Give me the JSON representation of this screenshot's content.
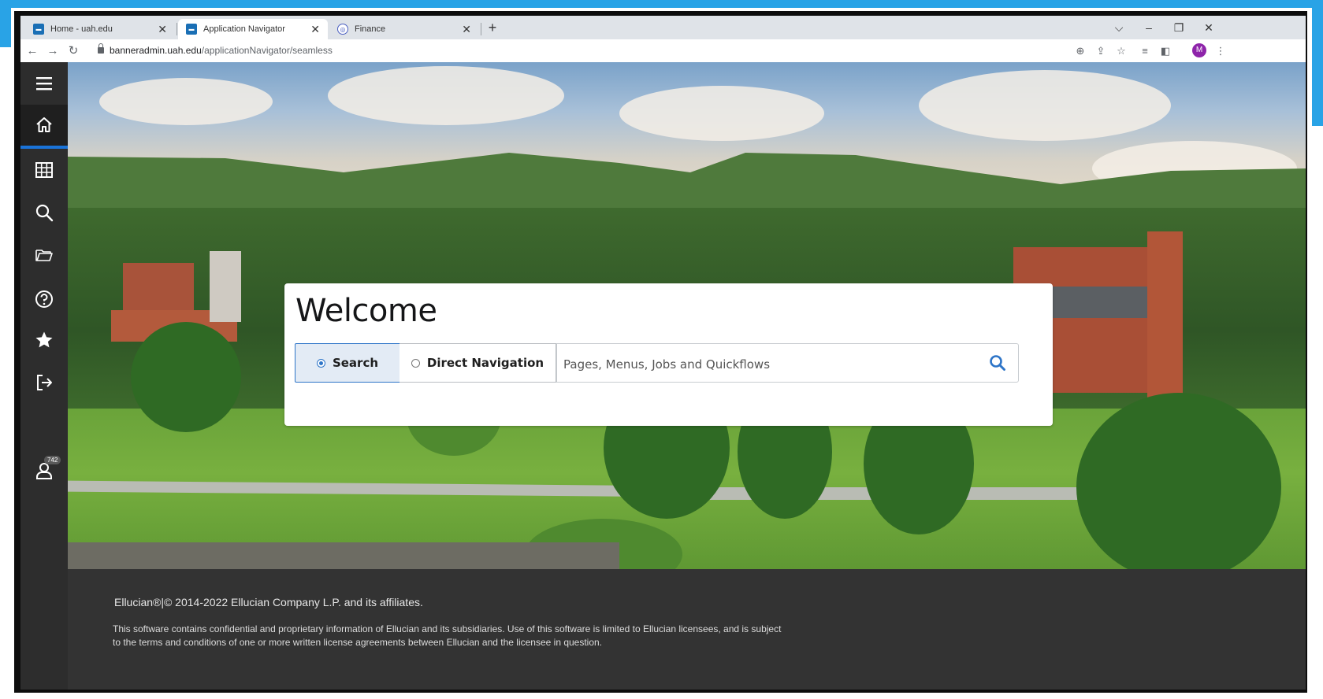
{
  "browser": {
    "tabs": [
      {
        "label": "Home - uah.edu",
        "active": false,
        "favicon_color": "#1a6fb5"
      },
      {
        "label": "Application Navigator",
        "active": true,
        "favicon_color": "#1a6fb5"
      },
      {
        "label": "Finance",
        "active": false,
        "favicon_color": "#4a5fc1"
      }
    ],
    "new_tab_icon": "plus-icon",
    "url_host": "banneradmin.uah.edu",
    "url_path": "/applicationNavigator/seamless",
    "profile_initial": "M",
    "profile_color": "#8e24aa"
  },
  "sidebar": {
    "items": [
      {
        "icon": "menu-icon"
      },
      {
        "icon": "home-icon",
        "active": true
      },
      {
        "icon": "grid-icon"
      },
      {
        "icon": "search-icon"
      },
      {
        "icon": "folder-icon"
      },
      {
        "icon": "help-icon"
      },
      {
        "icon": "star-icon"
      },
      {
        "icon": "sign-out-icon"
      }
    ],
    "notifications_icon": "user-icon",
    "notifications_count": "742",
    "accent": "#1a73d8"
  },
  "welcome": {
    "title": "Welcome",
    "mode_search_label": "Search",
    "mode_direct_label": "Direct Navigation",
    "selected_mode": "Search",
    "search_placeholder": "Pages, Menus, Jobs and Quickflows",
    "search_value": ""
  },
  "footer": {
    "copyright": "Ellucian®|© 2014-2022 Ellucian Company L.P. and its affiliates.",
    "disclaimer": "This software contains confidential and proprietary information of Ellucian and its subsidiaries. Use of this software is limited to Ellucian licensees, and is subject to the terms and conditions of one or more written license agreements between Ellucian and the licensee in question."
  },
  "colors": {
    "sidebar_bg": "#2d2d2d",
    "footer_bg": "#333333",
    "primary_blue": "#2e75c8"
  }
}
